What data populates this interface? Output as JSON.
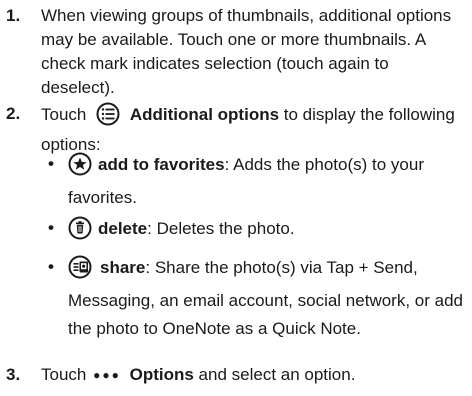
{
  "steps": [
    {
      "number": "1.",
      "lines": [
        "When viewing groups of thumbnails, additional options",
        "may be available. Touch one or more thumbnails. A",
        "check mark indicates selection (touch again to",
        "deselect)."
      ]
    },
    {
      "number": "2.",
      "prefix": "Touch",
      "bold": "Additional options",
      "suffix": "to display the following",
      "line2": "options:",
      "icon": "additional-options-icon"
    },
    {
      "number": "3.",
      "prefix": "Touch",
      "bold": "Options",
      "suffix": "and select an option.",
      "icon": "more-dots-icon"
    }
  ],
  "bullets": [
    {
      "icon": "star-icon",
      "bold": "add to favorites",
      "text": ": Adds the photo(s) to your",
      "line2": "favorites."
    },
    {
      "icon": "trash-icon",
      "bold": "delete",
      "text": ": Deletes the photo."
    },
    {
      "icon": "share-icon",
      "bold": "share",
      "text": ": Share the photo(s) via Tap + Send,",
      "line2": "Messaging, an email account, social network, or add",
      "line3": "the photo to OneNote as a Quick Note."
    }
  ]
}
